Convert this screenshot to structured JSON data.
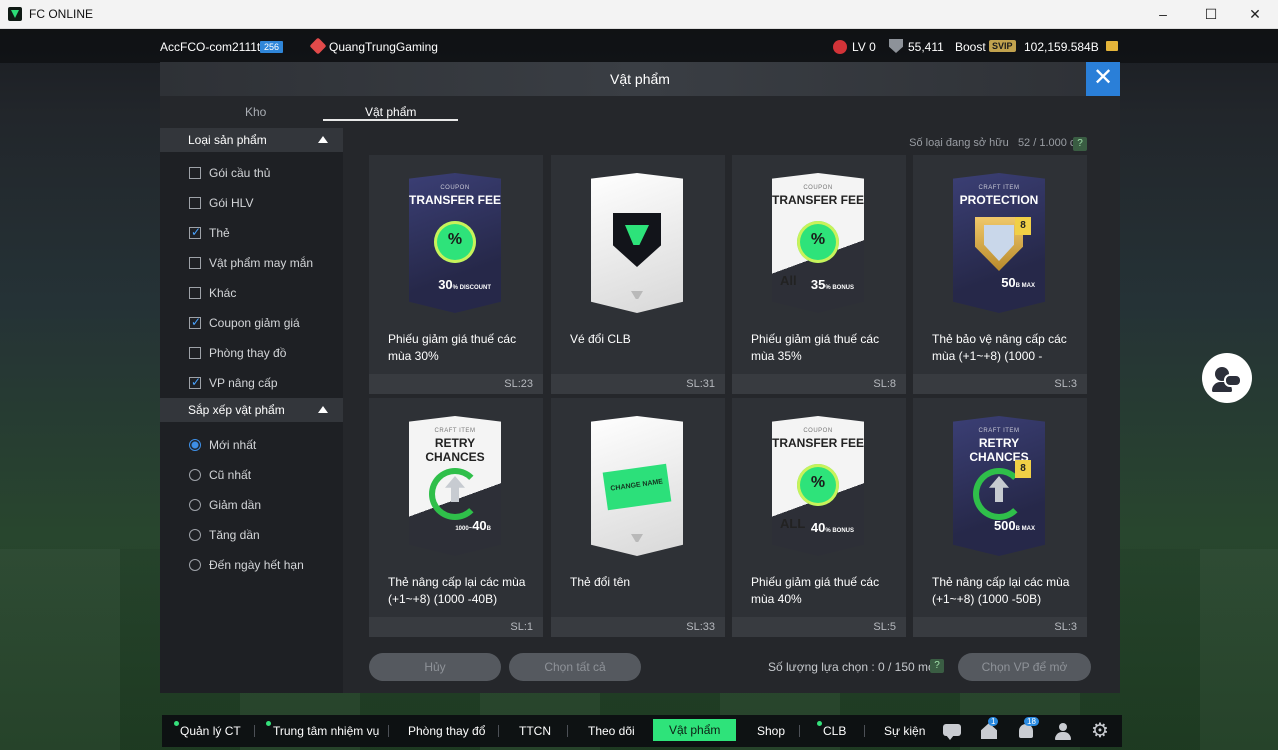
{
  "window": {
    "title": "FC ONLINE",
    "controls": [
      "–",
      "☐",
      "✕"
    ]
  },
  "topbar": {
    "account": "AccFCO-com2111t",
    "account_badge": "256",
    "team": "QuangTrungGaming",
    "level": "LV 0",
    "points": "55,411",
    "boost": "Boost",
    "svip": "SVIP",
    "bp": "102,159.584B"
  },
  "modal": {
    "title": "Vật phẩm",
    "tabs": [
      {
        "label": "Kho",
        "active": false
      },
      {
        "label": "Vật phẩm",
        "active": true
      }
    ],
    "owned_label": "Số loại đang sở hữu",
    "owned_value": "52 / 1.000 cái",
    "help": "?"
  },
  "sidebar": {
    "product_section": "Loại sản phẩm",
    "product_types": [
      {
        "label": "Gói cầu thủ",
        "checked": false
      },
      {
        "label": "Gói HLV",
        "checked": false
      },
      {
        "label": "Thẻ",
        "checked": true
      },
      {
        "label": "Vật phẩm may mắn",
        "checked": false
      },
      {
        "label": "Khác",
        "checked": false
      },
      {
        "label": "Coupon giảm giá",
        "checked": true
      },
      {
        "label": "Phòng thay đồ",
        "checked": false
      },
      {
        "label": "VP nâng cấp",
        "checked": true
      }
    ],
    "sort_section": "Sắp xếp vật phẩm",
    "sort_options": [
      {
        "label": "Mới nhất",
        "selected": true
      },
      {
        "label": "Cũ nhất",
        "selected": false
      },
      {
        "label": "Giảm dần",
        "selected": false
      },
      {
        "label": "Tăng dần",
        "selected": false
      },
      {
        "label": "Đến ngày hết hạn",
        "selected": false
      }
    ]
  },
  "items": [
    {
      "name": "Phiếu giảm giá thuế các mùa 30%",
      "qty": "SL:23",
      "card": {
        "kicker": "COUPON",
        "title": "TRANSFER FEE",
        "seal": "%",
        "value": "30",
        "unit": "% DISCOUNT"
      }
    },
    {
      "name": "Vé đổi CLB",
      "qty": "SL:31",
      "card": {
        "kicker": "",
        "title": "",
        "seal": "",
        "value": "",
        "unit": ""
      }
    },
    {
      "name": "Phiếu giảm giá thuế các mùa 35%",
      "qty": "SL:8",
      "card": {
        "kicker": "COUPON",
        "title": "TRANSFER FEE",
        "seal": "%",
        "value": "35",
        "unit": "% BONUS",
        "tag": "All"
      }
    },
    {
      "name": "Thẻ bảo vệ nâng cấp các mùa (+1~+8) (1000 -",
      "qty": "SL:3",
      "card": {
        "kicker": "CRAFT ITEM",
        "title": "PROTECTION",
        "level": "8",
        "value": "50",
        "unit": "B MAX"
      }
    },
    {
      "name": "Thẻ nâng cấp lại các mùa (+1~+8) (1000 -40B)",
      "qty": "SL:1",
      "card": {
        "kicker": "CRAFT ITEM",
        "title": "RETRY CHANCES",
        "value": "40",
        "unit": "B",
        "prefix": "1000~"
      }
    },
    {
      "name": "Thẻ đổi tên",
      "qty": "SL:33",
      "card": {
        "ticket": "CHANGE NAME"
      }
    },
    {
      "name": "Phiếu giảm giá thuế các mùa 40%",
      "qty": "SL:5",
      "card": {
        "kicker": "COUPON",
        "title": "TRANSFER FEE",
        "seal": "%",
        "value": "40",
        "unit": "% BONUS",
        "tag": "ALL"
      }
    },
    {
      "name": "Thẻ nâng cấp lại các mùa (+1~+8) (1000 -50B)",
      "qty": "SL:3",
      "card": {
        "kicker": "CRAFT ITEM",
        "title": "RETRY CHANCES",
        "level": "8",
        "value": "500",
        "unit": "B MAX"
      }
    }
  ],
  "footer": {
    "cancel": "Hủy",
    "select_all": "Chọn tất cả",
    "selection_label": "Số lượng lựa chọn : 0 / 150 món",
    "choose_button": "Chọn VP để mở"
  },
  "bottom_nav": [
    {
      "label": "Quản lý CT",
      "dot": true
    },
    {
      "label": "Trung tâm nhiệm vụ",
      "dot": true
    },
    {
      "label": "Phòng thay đổ",
      "dot": false
    },
    {
      "label": "TTCN",
      "dot": false
    },
    {
      "label": "Theo dõi",
      "dot": false
    },
    {
      "label": "Vật phẩm",
      "dot": false,
      "active": true
    },
    {
      "label": "Shop",
      "dot": false
    },
    {
      "label": "CLB",
      "dot": true
    },
    {
      "label": "Sự kiện",
      "dot": false
    }
  ],
  "nav_icons": [
    {
      "icon": "chat-icon",
      "badge": ""
    },
    {
      "icon": "home-icon",
      "badge": "1"
    },
    {
      "icon": "bell-icon",
      "badge": "18"
    },
    {
      "icon": "profile-icon",
      "badge": ""
    },
    {
      "icon": "settings-icon",
      "badge": ""
    }
  ]
}
